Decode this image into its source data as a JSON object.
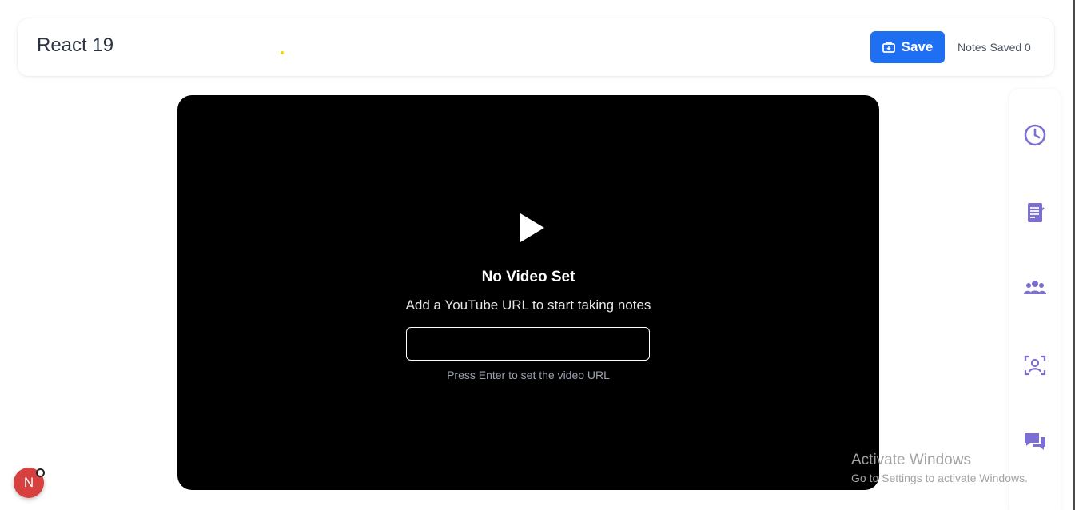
{
  "header": {
    "title": "React 19",
    "save_label": "Save",
    "notes_saved": "Notes Saved 0"
  },
  "video": {
    "play_icon": "play-icon",
    "empty_title": "No Video Set",
    "empty_subtitle": "Add a YouTube URL to start taking notes",
    "url_input_value": "",
    "url_hint": "Press Enter to set the video URL"
  },
  "side_rail": {
    "accent_color": "#7b6fcf",
    "items": [
      {
        "icon": "clock-icon"
      },
      {
        "icon": "notes-icon"
      },
      {
        "icon": "users-icon"
      },
      {
        "icon": "face-scan-icon"
      },
      {
        "icon": "chat-icon"
      }
    ]
  },
  "system": {
    "activation_title": "Activate Windows",
    "activation_subtitle": "Go to Settings to activate Windows."
  },
  "dev_badge": {
    "letter": "N",
    "color": "#d6403f"
  },
  "colors": {
    "primary": "#1f6ff2",
    "video_bg": "#000000"
  }
}
